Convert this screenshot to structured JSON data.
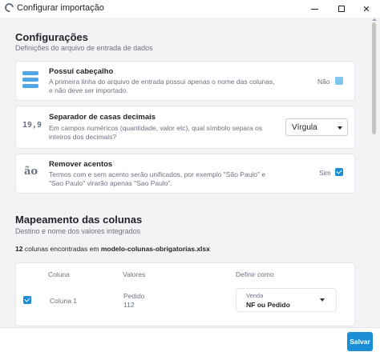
{
  "window": {
    "title": "Configurar importação",
    "app_icon": "spinner-c-icon",
    "controls": [
      "minimize-icon",
      "maximize-icon",
      "close-icon"
    ],
    "close_glyph": "✕"
  },
  "settings": {
    "title": "Configurações",
    "subtitle": "Definições do arquivo de entrada de dados",
    "header_row": {
      "icon": "table-rows-icon",
      "title": "Possui cabeçalho",
      "description": "A primeira linha do arquivo de entrada possui apenas o nome das colunas, e não deve ser importado.",
      "toggle_label": "Não",
      "checked": false
    },
    "decimal_separator": {
      "icon": "decimal-number-icon",
      "icon_text": "19,9",
      "title": "Separador de casas decimais",
      "description": "Em campos numéricos (quantidade, valor etc), qual símbolo separa os inteiros dos decimais?",
      "selected": "Vírgula"
    },
    "remove_accents": {
      "icon": "accent-icon",
      "icon_text": "ão",
      "title": "Remover acentos",
      "description": "Termos com e sem acento serão unificados, por exemplo \"São Paulo\" e \"Sao Paulo\" virarão apenas \"Sao Paulo\".",
      "toggle_label": "Sim",
      "checked": true
    }
  },
  "mapping": {
    "title": "Mapeamento das colunas",
    "subtitle": "Destino e nome dos valores integrados",
    "count": "12",
    "count_text": "colunas encontradas em",
    "filename": "modelo-colunas-obrigatorias.xlsx",
    "headers": {
      "column": "Coluna",
      "values": "Valores",
      "define": "Definir como"
    },
    "rows": [
      {
        "checked": true,
        "column": "Coluna 1",
        "values": [
          "Pedido",
          "112"
        ],
        "define_category": "Venda",
        "define_value": "NF ou Pedido"
      }
    ]
  },
  "footer": {
    "save_label": "Salvar"
  },
  "colors": {
    "accent": "#1a8fd6",
    "background": "#f3f3f5",
    "card": "#ffffff"
  }
}
